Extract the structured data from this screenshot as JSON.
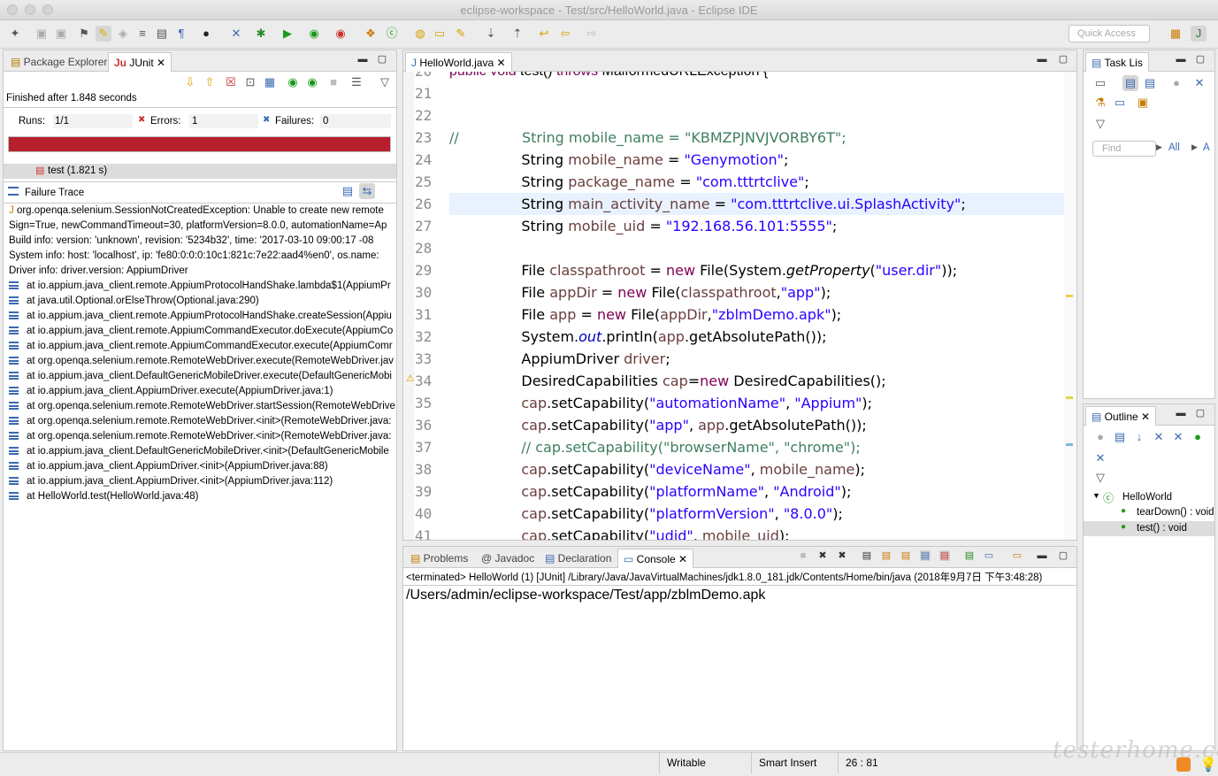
{
  "window": {
    "title": "eclipse-workspace - Test/src/HelloWorld.java - Eclipse IDE"
  },
  "toolbar": {
    "quick_access_placeholder": "Quick Access"
  },
  "left_panel": {
    "tabs": [
      {
        "label": "Package Explorer"
      },
      {
        "label": "JUnit"
      }
    ],
    "finished": "Finished after 1.848 seconds",
    "runs_label": "Runs:",
    "runs_value": "1/1",
    "errors_label": "Errors:",
    "errors_value": "1",
    "failures_label": "Failures:",
    "failures_value": "0",
    "progress": 1.0,
    "progress_color": "#b81f2c",
    "test_item": "test (1.821 s)",
    "failure_trace_title": "Failure Trace",
    "trace_header": [
      "org.openqa.selenium.SessionNotCreatedException: Unable to create new remote",
      "Sign=True, newCommandTimeout=30, platformVersion=8.0.0, automationName=Ap",
      "Build info: version: 'unknown', revision: '5234b32', time: '2017-03-10 09:00:17 -08",
      "System info: host: 'localhost', ip: 'fe80:0:0:0:10c1:821c:7e22:aad4%en0', os.name:",
      "Driver info: driver.version: AppiumDriver"
    ],
    "trace_frames": [
      "at io.appium.java_client.remote.AppiumProtocolHandShake.lambda$1(AppiumPr",
      "at java.util.Optional.orElseThrow(Optional.java:290)",
      "at io.appium.java_client.remote.AppiumProtocolHandShake.createSession(Appiu",
      "at io.appium.java_client.remote.AppiumCommandExecutor.doExecute(AppiumCo",
      "at io.appium.java_client.remote.AppiumCommandExecutor.execute(AppiumComr",
      "at org.openqa.selenium.remote.RemoteWebDriver.execute(RemoteWebDriver.jav",
      "at io.appium.java_client.DefaultGenericMobileDriver.execute(DefaultGenericMobi",
      "at io.appium.java_client.AppiumDriver.execute(AppiumDriver.java:1)",
      "at org.openqa.selenium.remote.RemoteWebDriver.startSession(RemoteWebDrive",
      "at org.openqa.selenium.remote.RemoteWebDriver.<init>(RemoteWebDriver.java:",
      "at org.openqa.selenium.remote.RemoteWebDriver.<init>(RemoteWebDriver.java:",
      "at io.appium.java_client.DefaultGenericMobileDriver.<init>(DefaultGenericMobile",
      "at io.appium.java_client.AppiumDriver.<init>(AppiumDriver.java:88)",
      "at io.appium.java_client.AppiumDriver.<init>(AppiumDriver.java:112)",
      "at HelloWorld.test(HelloWorld.java:48)"
    ]
  },
  "editor": {
    "tab": "HelloWorld.java",
    "top_partial": "public void test() throws MalformedURLException {",
    "lines": [
      {
        "n": "21",
        "html": ""
      },
      {
        "n": "22",
        "html": ""
      },
      {
        "n": "23",
        "html": "<span class='cmt'>//              String mobile_name = \"KBMZPJNVJVORBY6T\";</span>"
      },
      {
        "n": "24",
        "html": "                String <span class='var'>mobile_name</span> = <span class='str'>\"Genymotion\"</span>;"
      },
      {
        "n": "25",
        "html": "                String <span class='var'>package_name</span> = <span class='str'>\"com.tttrtclive\"</span>;"
      },
      {
        "n": "26",
        "html": "                String <span class='var'>main_activity_name</span> = <span class='str'>\"com.tttrtclive.ui.SplashActivity\"</span>;"
      },
      {
        "n": "27",
        "html": "                String <span class='var'>mobile_uid</span> = <span class='str'>\"192.168.56.101:5555\"</span>;"
      },
      {
        "n": "28",
        "html": ""
      },
      {
        "n": "29",
        "html": "                File <span class='var'>classpathroot</span> = <span class='kw'>new</span> File(System.<i>getProperty</i>(<span class='str'>\"user.dir\"</span>));"
      },
      {
        "n": "30",
        "html": "                File <span class='var'>appDir</span> = <span class='kw'>new</span> File(<span class='var'>classpathroot</span>,<span class='str'>\"app\"</span>);"
      },
      {
        "n": "31",
        "html": "                File <span class='var'>app</span> = <span class='kw'>new</span> File(<span class='var'>appDir</span>,<span class='str'>\"zblmDemo.apk\"</span>);"
      },
      {
        "n": "32",
        "html": "                System.<i class='fld'>out</i>.println(<span class='var'>app</span>.getAbsolutePath());"
      },
      {
        "n": "33",
        "html": "                AppiumDriver <span class='var'>driver</span>;"
      },
      {
        "n": "34",
        "html": "                DesiredCapabilities <span class='var'>cap</span>=<span class='kw'>new</span> DesiredCapabilities();"
      },
      {
        "n": "35",
        "html": "                <span class='var'>cap</span>.setCapability(<span class='str'>\"automationName\"</span>, <span class='str'>\"Appium\"</span>);"
      },
      {
        "n": "36",
        "html": "                <span class='var'>cap</span>.setCapability(<span class='str'>\"app\"</span>, <span class='var'>app</span>.getAbsolutePath());"
      },
      {
        "n": "37",
        "html": "                <span class='cmt'>// cap.setCapability(\"browserName\", \"chrome\");</span>"
      },
      {
        "n": "38",
        "html": "                <span class='var'>cap</span>.setCapability(<span class='str'>\"deviceName\"</span>, <span class='var'>mobile_name</span>);"
      },
      {
        "n": "39",
        "html": "                <span class='var'>cap</span>.setCapability(<span class='str'>\"platformName\"</span>, <span class='str'>\"Android\"</span>);"
      },
      {
        "n": "40",
        "html": "                <span class='var'>cap</span>.setCapability(<span class='str'>\"platformVersion\"</span>, <span class='str'>\"8.0.0\"</span>);"
      },
      {
        "n": "41",
        "html": "                <span class='var'>cap</span>.setCapability(<span class='str'>\"udid\"</span>, <span class='var'>mobile_uid</span>);"
      }
    ]
  },
  "console": {
    "tabs": [
      {
        "label": "Problems"
      },
      {
        "label": "Javadoc"
      },
      {
        "label": "Declaration"
      },
      {
        "label": "Console"
      }
    ],
    "header": "<terminated> HelloWorld (1) [JUnit] /Library/Java/JavaVirtualMachines/jdk1.8.0_181.jdk/Contents/Home/bin/java (2018年9月7日 下午3:48:28)",
    "output": "/Users/admin/eclipse-workspace/Test/app/zblmDemo.apk"
  },
  "task_list": {
    "tab": "Task Lis",
    "find_placeholder": "Find",
    "all_label": "All",
    "a_label": "A"
  },
  "outline": {
    "tab": "Outline",
    "root": "HelloWorld",
    "items": [
      "tearDown() : void",
      "test() : void"
    ]
  },
  "status": {
    "writable": "Writable",
    "insert": "Smart Insert",
    "position": "26 : 81"
  },
  "watermark": "testerhome.com"
}
